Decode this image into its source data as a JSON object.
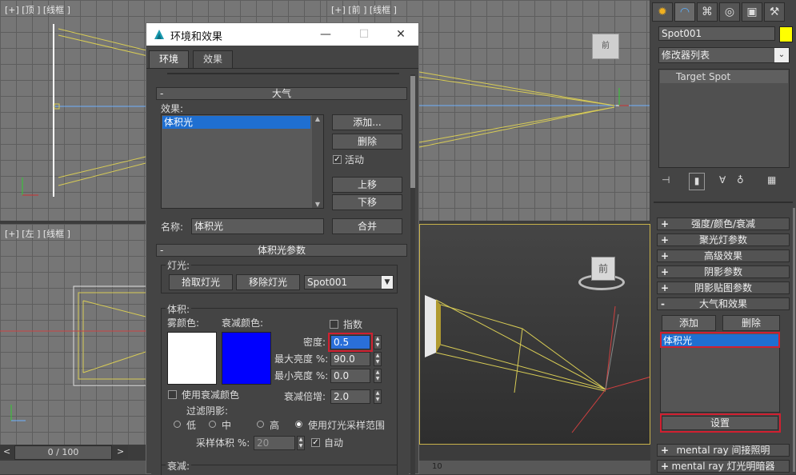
{
  "viewports": {
    "top": {
      "label": "[+] [顶 ] [线框 ]"
    },
    "front": {
      "label": "[+] [前 ] [线框 ]"
    },
    "left": {
      "label": "[+] [左 ] [线框 ]"
    },
    "persp": {
      "viewcube": "前"
    },
    "front_viewcube": "前"
  },
  "timeline": {
    "position": "0 / 100",
    "prev": "<",
    "next": ">",
    "tick": "10"
  },
  "dialog": {
    "title": "环境和效果",
    "tabs": [
      "环境",
      "效果"
    ],
    "atmosphere": {
      "header": "大气",
      "collapse": "-",
      "effects_label": "效果:",
      "effects": [
        "体积光"
      ],
      "add": "添加...",
      "delete": "删除",
      "active_label": "活动",
      "active_checked": true,
      "move_up": "上移",
      "move_down": "下移",
      "name_label": "名称:",
      "name_value": "体积光",
      "merge": "合并"
    },
    "volume_light": {
      "header": "体积光参数",
      "collapse": "-",
      "lights_group": "灯光:",
      "pick_light": "拾取灯光",
      "remove_light": "移除灯光",
      "light_select": "Spot001",
      "volume_group": "体积:",
      "fog_color_label": "雾颜色:",
      "fog_color": "#ffffff",
      "atten_color_label": "衰减颜色:",
      "atten_color": "#0000ff",
      "exponential": "指数",
      "density_label": "密度:",
      "density": "0.5",
      "max_bright_label": "最大亮度 %:",
      "max_bright": "90.0",
      "min_bright_label": "最小亮度 %:",
      "min_bright": "0.0",
      "use_atten_color": "使用衰减颜色",
      "atten_mult_label": "衰减倍增:",
      "atten_mult": "2.0",
      "filter_shadows": "过滤阴影:",
      "opt_low": "低",
      "opt_mid": "中",
      "opt_high": "高",
      "opt_use_light": "使用灯光采样范围",
      "sample_label": "采样体积 %:",
      "sample_value": "20",
      "auto_label": "自动",
      "auto_checked": true,
      "attenuation_group": "衰减:"
    }
  },
  "command_panel": {
    "object_name": "Spot001",
    "object_color": "#ffff00",
    "modifier_list": "修改器列表",
    "stack_item": "Target Spot",
    "rollouts": [
      "强度/颜色/衰减",
      "聚光灯参数",
      "高级效果",
      "阴影参数",
      "阴影贴图参数",
      "大气和效果"
    ],
    "rollout_plus": "+",
    "rollout_minus": "-",
    "atmos_add": "添加",
    "atmos_delete": "删除",
    "atmos_item": "体积光",
    "setup": "设置",
    "mr_rollouts": [
      "mental ray 间接照明",
      "mental ray 灯光明暗器"
    ]
  }
}
